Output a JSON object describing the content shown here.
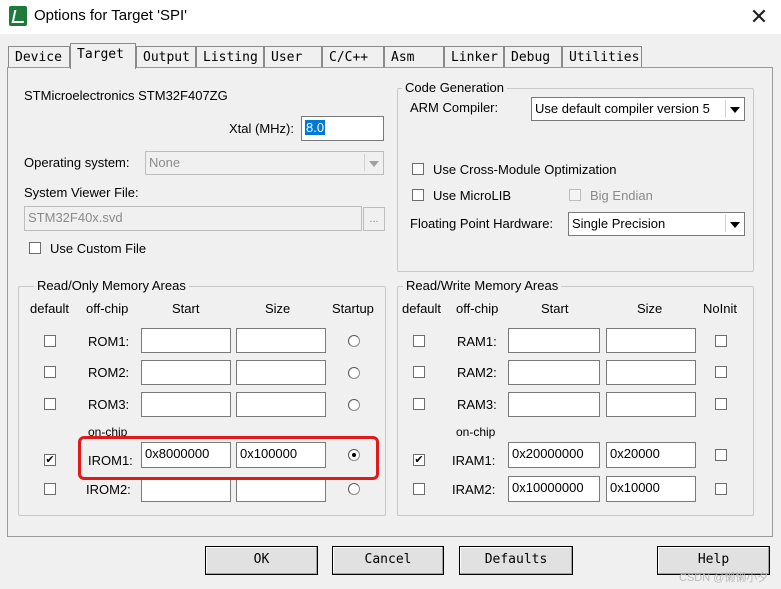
{
  "window": {
    "title": "Options for Target 'SPI'",
    "close_glyph": "✕"
  },
  "tabs": [
    "Device",
    "Target",
    "Output",
    "Listing",
    "User",
    "C/C++",
    "Asm",
    "Linker",
    "Debug",
    "Utilities"
  ],
  "active_tab": "Target",
  "device": {
    "name": "STMicroelectronics STM32F407ZG",
    "xtal_label": "Xtal (MHz):",
    "xtal_value": "8.0"
  },
  "os": {
    "label": "Operating system:",
    "value": "None"
  },
  "svf": {
    "label": "System Viewer File:",
    "value": "STM32F40x.svd",
    "browse": "...",
    "custom_label": "Use Custom File"
  },
  "codegen": {
    "legend": "Code Generation",
    "compiler_label": "ARM Compiler:",
    "compiler_value": "Use default compiler version 5",
    "cross_module": "Use Cross-Module Optimization",
    "microlib": "Use MicroLIB",
    "big_endian": "Big Endian",
    "fph_label": "Floating Point Hardware:",
    "fph_value": "Single Precision"
  },
  "rom": {
    "legend": "Read/Only Memory Areas",
    "headers": {
      "default": "default",
      "offchip": "off-chip",
      "start": "Start",
      "size": "Size",
      "startup": "Startup"
    },
    "onchip_label": "on-chip",
    "rows": [
      {
        "label": "ROM1:",
        "start": "",
        "size": "",
        "default": false,
        "startup": false
      },
      {
        "label": "ROM2:",
        "start": "",
        "size": "",
        "default": false,
        "startup": false
      },
      {
        "label": "ROM3:",
        "start": "",
        "size": "",
        "default": false,
        "startup": false
      },
      {
        "label": "IROM1:",
        "start": "0x8000000",
        "size": "0x100000",
        "default": true,
        "startup": true
      },
      {
        "label": "IROM2:",
        "start": "",
        "size": "",
        "default": false,
        "startup": false
      }
    ]
  },
  "ram": {
    "legend": "Read/Write Memory Areas",
    "headers": {
      "default": "default",
      "offchip": "off-chip",
      "start": "Start",
      "size": "Size",
      "noinit": "NoInit"
    },
    "onchip_label": "on-chip",
    "rows": [
      {
        "label": "RAM1:",
        "start": "",
        "size": "",
        "default": false,
        "noinit": false
      },
      {
        "label": "RAM2:",
        "start": "",
        "size": "",
        "default": false,
        "noinit": false
      },
      {
        "label": "RAM3:",
        "start": "",
        "size": "",
        "default": false,
        "noinit": false
      },
      {
        "label": "IRAM1:",
        "start": "0x20000000",
        "size": "0x20000",
        "default": true,
        "noinit": false
      },
      {
        "label": "IRAM2:",
        "start": "0x10000000",
        "size": "0x10000",
        "default": false,
        "noinit": false
      }
    ]
  },
  "buttons": {
    "ok": "OK",
    "cancel": "Cancel",
    "defaults": "Defaults",
    "help": "Help"
  },
  "watermark": "CSDN @懒懒小夕",
  "highlight_color": "#e01a1a"
}
